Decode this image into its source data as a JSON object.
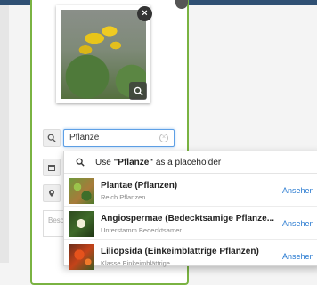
{
  "search": {
    "value": "Pflanze"
  },
  "dropdown": {
    "placeholder_prefix": "Use ",
    "placeholder_term": "\"Pflanze\"",
    "placeholder_suffix": " as a placeholder",
    "items": [
      {
        "title": "Plantae (Pflanzen)",
        "subtitle": "Reich Pflanzen",
        "link": "Ansehen"
      },
      {
        "title": "Angiospermae (Bedecktsamige Pflanze...",
        "subtitle": "Unterstamm Bedecktsamer",
        "link": "Ansehen"
      },
      {
        "title": "Liliopsida (Einkeimblättrige Pflanzen)",
        "subtitle": "Klasse Einkeimblättrige",
        "link": "Ansehen"
      }
    ]
  },
  "description": {
    "placeholder": "Besc"
  },
  "colors": {
    "accent": "#7ab342",
    "link": "#2a7bd1",
    "focus": "#5ea0e6"
  }
}
